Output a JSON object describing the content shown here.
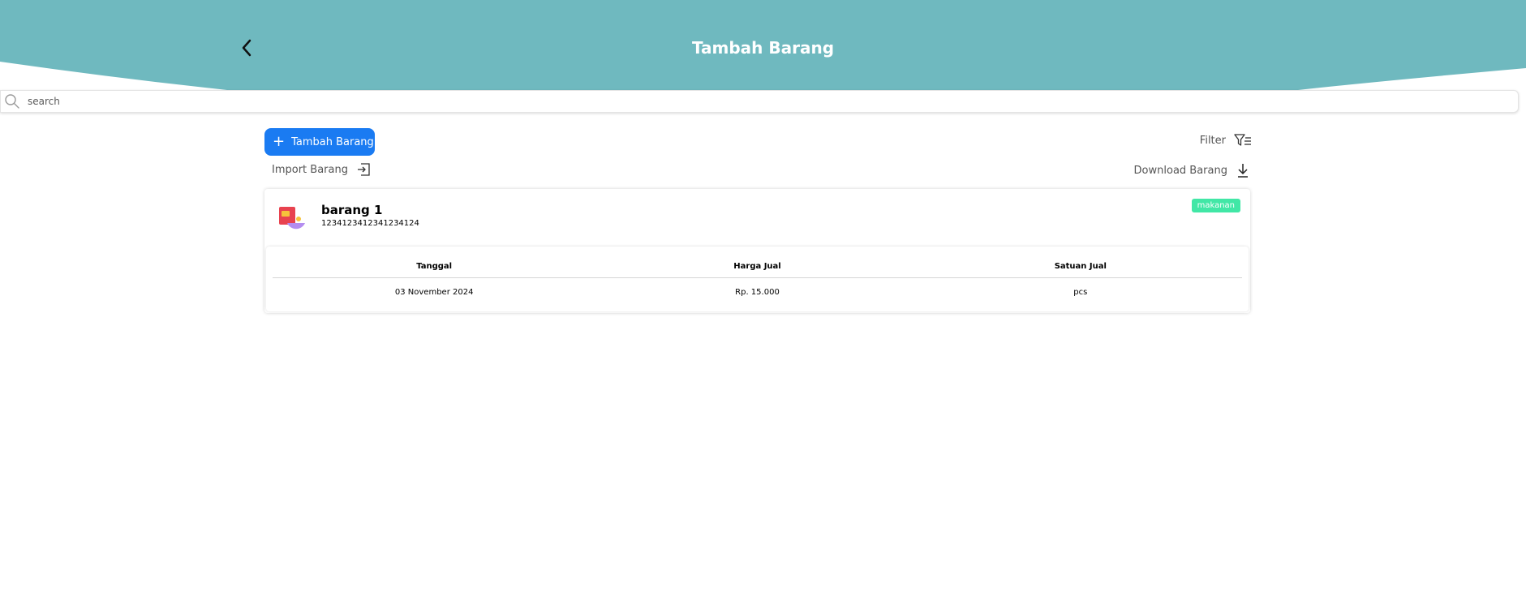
{
  "header": {
    "title": "Tambah Barang",
    "background_color": "#6fb9bf",
    "back_icon": "chevron-left-icon"
  },
  "search": {
    "placeholder": "search",
    "value": "",
    "icon": "search-icon"
  },
  "actions": {
    "add_label": "Tambah Barang",
    "add_color": "#1a7bf2",
    "filter_label": "Filter",
    "import_label": "Import Barang",
    "download_label": "Download Barang"
  },
  "items": [
    {
      "name": "barang 1",
      "code": "1234123412341234124",
      "category": "makanan",
      "category_color": "#41e7a6",
      "table": {
        "headers": [
          "Tanggal",
          "Harga Jual",
          "Satuan Jual"
        ],
        "rows": [
          [
            "03 November 2024",
            "Rp. 15.000",
            "pcs"
          ]
        ]
      }
    }
  ]
}
